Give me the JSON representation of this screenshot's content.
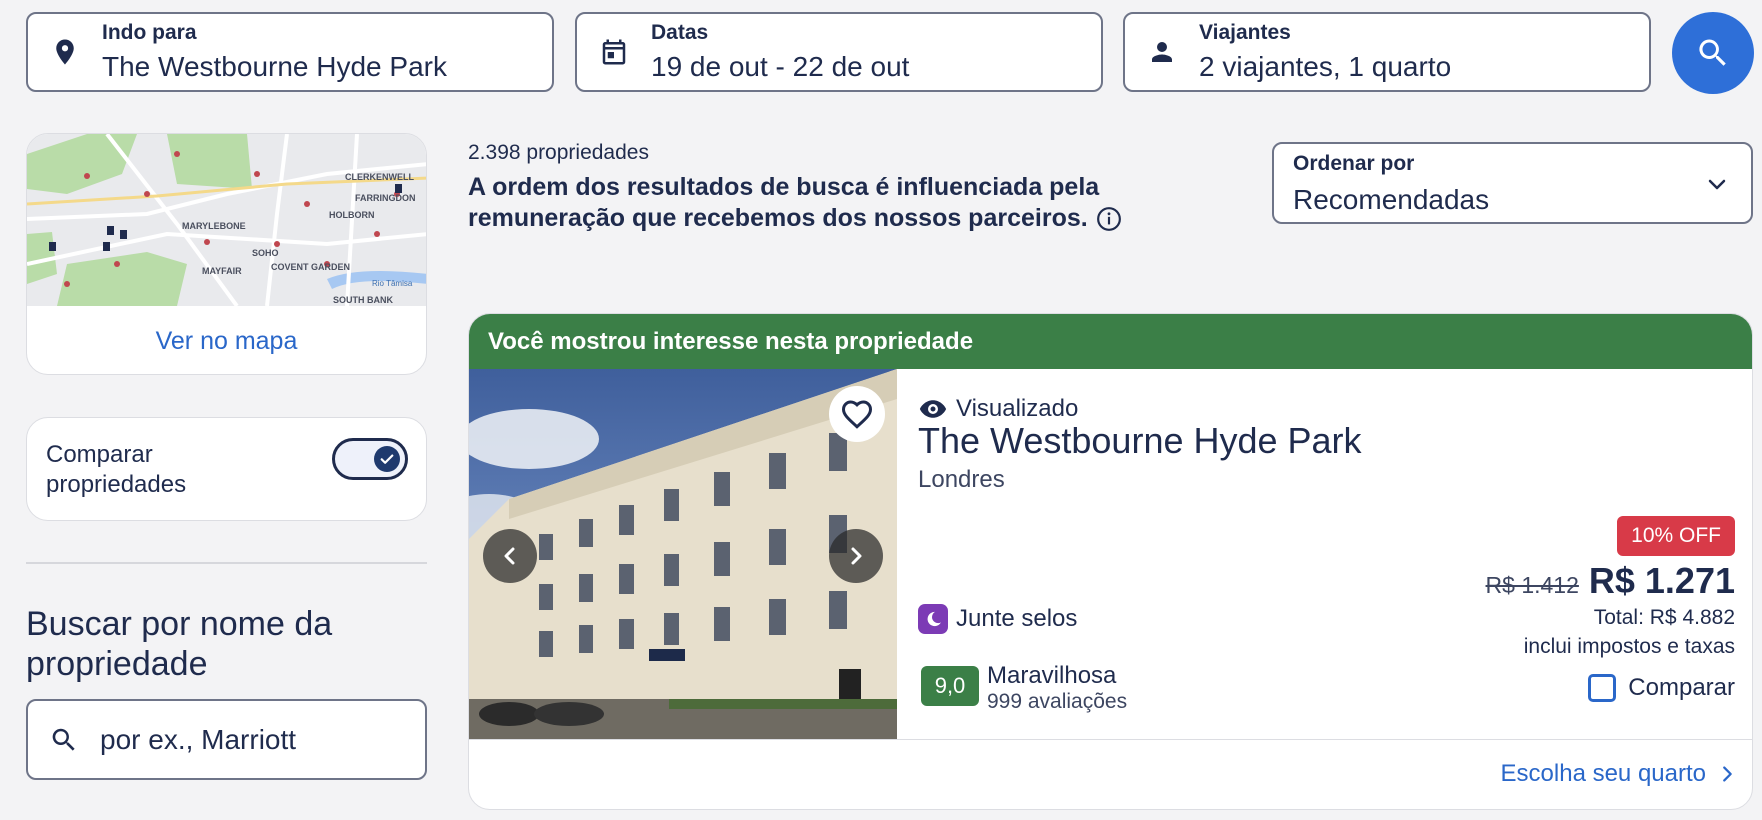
{
  "search": {
    "destination": {
      "label": "Indo para",
      "value": "The Westbourne Hyde Park",
      "icon": "location-pin-icon"
    },
    "dates": {
      "label": "Datas",
      "value": "19 de out - 22 de out",
      "icon": "calendar-icon"
    },
    "travelers": {
      "label": "Viajantes",
      "value": "2 viajantes, 1 quarto",
      "icon": "person-icon"
    },
    "button_icon": "search-icon",
    "button_color": "#2e6fd8"
  },
  "map": {
    "labels": [
      "MARYLEBONE",
      "SOHO",
      "MAYFAIR",
      "COVENT GARDEN",
      "HOLBORN",
      "CLERKENWELL",
      "FARRINGDON",
      "SOUTH BANK",
      "Rio Tâmisa"
    ],
    "link_label": "Ver no mapa"
  },
  "compare": {
    "label": "Comparar propriedades",
    "enabled": true
  },
  "name_search": {
    "title": "Buscar por nome da propriedade",
    "placeholder": "por ex., Marriott"
  },
  "results": {
    "count": "2.398 propriedades",
    "disclaimer": "A ordem dos resultados de busca é influenciada pela remuneração que recebemos dos nossos parceiros.",
    "sort_label": "Ordenar por",
    "sort_value": "Recomendadas"
  },
  "hotel": {
    "banner": "Você mostrou interesse nesta propriedade",
    "banner_color": "#3b7f47",
    "viewed_label": "Visualizado",
    "name": "The Westbourne Hyde Park",
    "city": "Londres",
    "stamps_label": "Junte selos",
    "score": "9,0",
    "score_label": "Maravilhosa",
    "reviews": "999 avaliações",
    "discount": "10% OFF",
    "discount_color": "#d83a48",
    "old_price": "R$ 1.412",
    "price": "R$ 1.271",
    "total": "Total: R$ 4.882",
    "taxes": "inclui impostos e taxas",
    "compare_label": "Comparar",
    "choose_room": "Escolha seu quarto"
  }
}
